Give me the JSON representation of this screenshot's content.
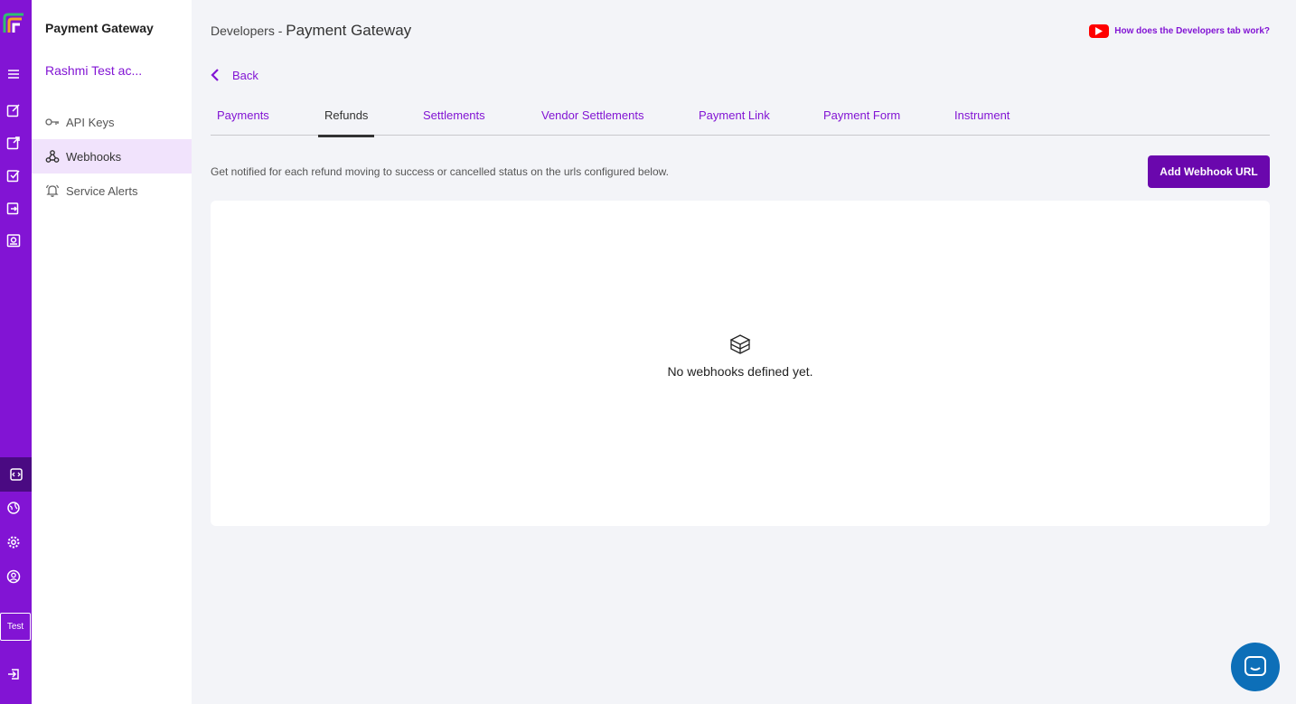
{
  "rail": {
    "test_badge": "Test"
  },
  "sidebar": {
    "product_title": "Payment Gateway",
    "account_name": "Rashmi Test ac...",
    "items": [
      {
        "label": "API Keys",
        "icon": "key-icon"
      },
      {
        "label": "Webhooks",
        "icon": "webhook-icon"
      },
      {
        "label": "Service Alerts",
        "icon": "bell-icon"
      }
    ]
  },
  "header": {
    "prefix": "Developers - ",
    "title": "Payment Gateway",
    "help_link": "How does the Developers tab work?"
  },
  "back_label": "Back",
  "tabs": [
    {
      "label": "Payments"
    },
    {
      "label": "Refunds"
    },
    {
      "label": "Settlements"
    },
    {
      "label": "Vendor Settlements"
    },
    {
      "label": "Payment Link"
    },
    {
      "label": "Payment Form"
    },
    {
      "label": "Instrument"
    }
  ],
  "active_tab": "Refunds",
  "description": "Get notified for each refund moving to success or cancelled status on the urls configured below.",
  "add_button_label": "Add Webhook URL",
  "empty_state": {
    "text": "No webhooks defined yet.",
    "icon": "box-icon"
  },
  "colors": {
    "brand": "#8214d4",
    "button": "#6a07ad",
    "chat": "#0d6fb8"
  }
}
